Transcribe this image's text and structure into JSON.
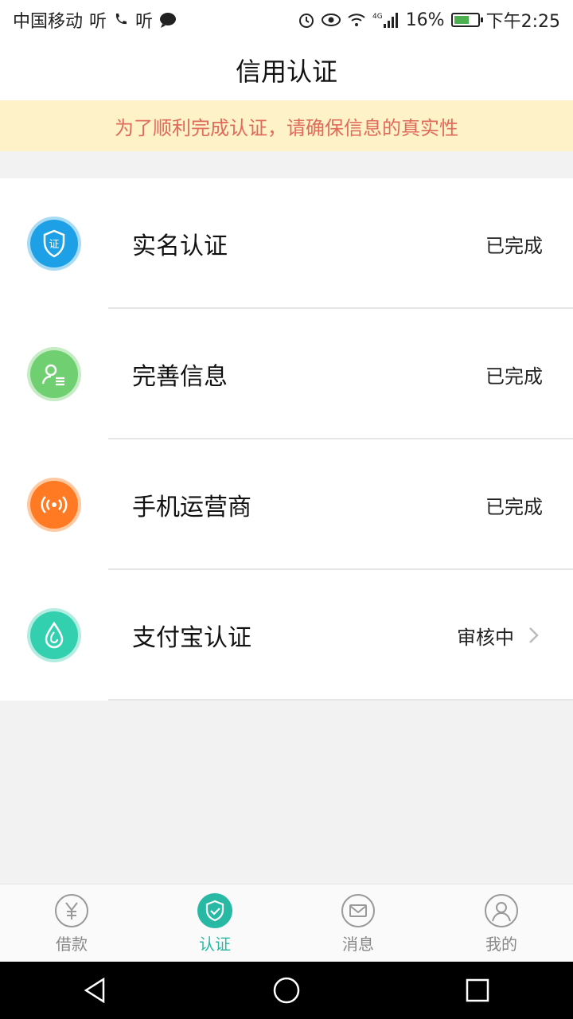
{
  "status_bar": {
    "carrier": "中国移动",
    "listen1": "听",
    "listen2": "听",
    "battery_pct": "16%",
    "time": "下午2:25",
    "battery_level": 0.16,
    "network": "4G"
  },
  "header": {
    "title": "信用认证"
  },
  "notice": {
    "text": "为了顺利完成认证，请确保信息的真实性"
  },
  "list": {
    "items": [
      {
        "label": "实名认证",
        "status": "已完成",
        "icon": "id-shield-icon",
        "color": "#1ea0e6",
        "has_chevron": false
      },
      {
        "label": "完善信息",
        "status": "已完成",
        "icon": "user-info-icon",
        "color": "#70cf70",
        "has_chevron": false
      },
      {
        "label": "手机运营商",
        "status": "已完成",
        "icon": "signal-icon",
        "color": "#ff7a22",
        "has_chevron": false
      },
      {
        "label": "支付宝认证",
        "status": "审核中",
        "icon": "alipay-icon",
        "color": "#33d0b0",
        "has_chevron": true
      }
    ]
  },
  "tabbar": {
    "tabs": [
      {
        "label": "借款",
        "icon": "yuan-icon",
        "active": false
      },
      {
        "label": "认证",
        "icon": "shield-check-icon",
        "active": true
      },
      {
        "label": "消息",
        "icon": "mail-icon",
        "active": false
      },
      {
        "label": "我的",
        "icon": "user-icon",
        "active": false
      }
    ]
  },
  "colors": {
    "accent": "#27b9a4",
    "notice_bg": "#fdf2c8",
    "notice_text": "#e06b5a"
  }
}
